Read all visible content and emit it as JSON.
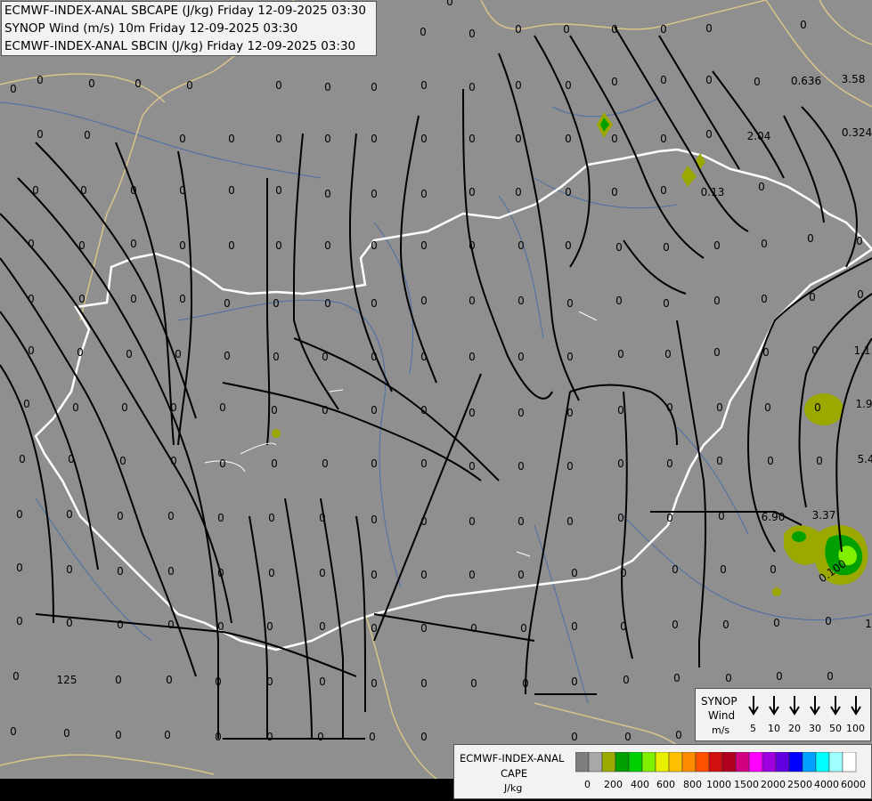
{
  "header": {
    "line1": "ECMWF-INDEX-ANAL SBCAPE (J/kg) Friday 12-09-2025 03:30",
    "line2": "SYNOP Wind (m/s) 10m Friday 12-09-2025 03:30",
    "line3": "ECMWF-INDEX-ANAL SBCIN (J/kg) Friday 12-09-2025 03:30"
  },
  "wind_legend": {
    "title_line1": "SYNOP",
    "title_line2": "Wind",
    "unit": "m/s",
    "speeds": [
      "5",
      "10",
      "20",
      "30",
      "50",
      "100"
    ]
  },
  "cape_legend": {
    "title_line1": "ECMWF-INDEX-ANAL",
    "title_line2": "CAPE",
    "unit": "J/kg",
    "tick_labels": [
      "0",
      "200",
      "400",
      "600",
      "800",
      "1000",
      "1500",
      "2000",
      "2500",
      "4000",
      "6000"
    ],
    "colors": [
      "#7d7d7d",
      "#a8a8a8",
      "#9aa800",
      "#00a000",
      "#00d000",
      "#80f000",
      "#e8f000",
      "#ffc000",
      "#ff8c00",
      "#ff5000",
      "#d01010",
      "#b00020",
      "#d00080",
      "#ff00ff",
      "#a000e0",
      "#6000e0",
      "#0000ff",
      "#00a0ff",
      "#00ffff",
      "#a0ffff",
      "#ffffff"
    ]
  },
  "values": {
    "zeros": "0",
    "special": [
      {
        "text": "0.636"
      },
      {
        "text": "3.58"
      },
      {
        "text": "2.04"
      },
      {
        "text": "0.324"
      },
      {
        "text": "0.13"
      },
      {
        "text": "1.1"
      },
      {
        "text": "1.9"
      },
      {
        "text": "5.4"
      },
      {
        "text": "6.90"
      },
      {
        "text": "3.37"
      },
      {
        "text": "0.100"
      },
      {
        "text": "125"
      },
      {
        "text": "1"
      }
    ]
  },
  "colors": {
    "background": "#8f8f8f",
    "border": "#ffffff",
    "river": "#4a6fa5",
    "country_border": "#d9c48a",
    "stream": "#000000"
  }
}
